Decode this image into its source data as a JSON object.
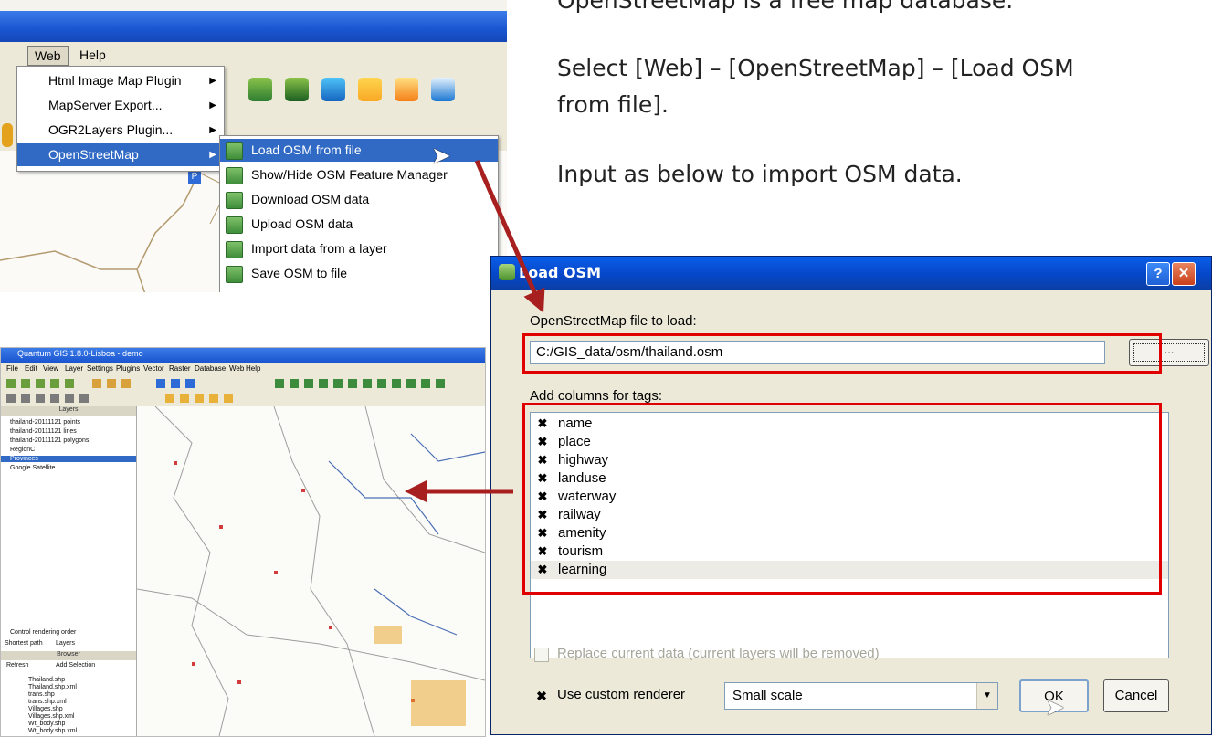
{
  "slide": {
    "line1": "OpenStreetMap is a free map database.",
    "line2": "Select [Web] – [OpenStreetMap] – [Load OSM",
    "line3": "from file].",
    "line4": "Input as below to import OSM data."
  },
  "qgis_menu": {
    "menubar": [
      "Web",
      "Help"
    ],
    "web_menu_items": [
      {
        "label": "Html Image Map Plugin",
        "has_submenu": true
      },
      {
        "label": "MapServer Export...",
        "has_submenu": true
      },
      {
        "label": "OGR2Layers Plugin...",
        "has_submenu": true
      },
      {
        "label": "OpenStreetMap",
        "has_submenu": true
      }
    ],
    "osm_submenu_items": [
      "Load OSM from file",
      "Show/Hide OSM Feature Manager",
      "Download OSM data",
      "Upload OSM data",
      "Import data from a layer",
      "Save OSM to file"
    ]
  },
  "thumbnail": {
    "title": "Quantum GIS 1.8.0-Lisboa - demo",
    "menu": [
      "File",
      "Edit",
      "View",
      "Layer",
      "Settings",
      "Plugins",
      "Vector",
      "Raster",
      "Database",
      "Web",
      "Help"
    ],
    "layers_header": "Layers",
    "layers": [
      "thailand-20111121 points",
      "thailand-20111121 lines",
      "thailand-20111121 polygons",
      "RegionC",
      "Provinces",
      "Google Satellite"
    ],
    "control_rendering": "Control rendering order",
    "tabs": [
      "Shortest path",
      "Layers"
    ],
    "browser_header": "Browser",
    "browser_buttons": [
      "Refresh",
      "Add Selection"
    ],
    "browser_files": [
      "Thailand.shp",
      "Thailand.shp.xml",
      "trans.shp",
      "trans.shp.xml",
      "Villages.shp",
      "Villages.shp.xml",
      "Wt_body.shp",
      "Wt_body.shp.xml"
    ]
  },
  "dialog": {
    "title": "Load OSM",
    "file_label": "OpenStreetMap file to load:",
    "file_path": "C:/GIS_data/osm/thailand.osm",
    "browse_label": "...",
    "tags_label": "Add columns for tags:",
    "tags": [
      "name",
      "place",
      "highway",
      "landuse",
      "waterway",
      "railway",
      "amenity",
      "tourism",
      "learning"
    ],
    "replace_label": "Replace current data (current layers will be removed)",
    "custom_renderer_label": "Use custom renderer",
    "renderer_value": "Small scale",
    "ok_label": "OK",
    "cancel_label": "Cancel"
  },
  "colors": {
    "highlight": "#316ac5",
    "red_box": "#e00000",
    "arrow": "#a81f1f",
    "xp_title": "#0647c9"
  }
}
